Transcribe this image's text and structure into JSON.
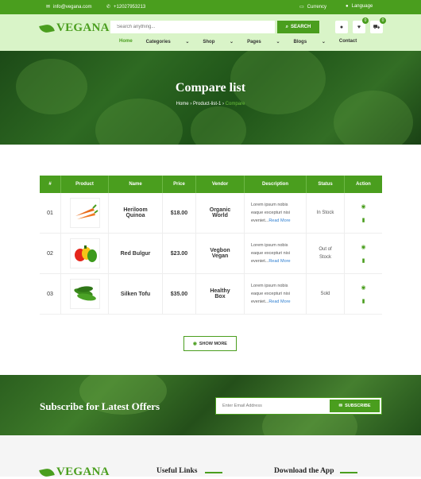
{
  "topbar": {
    "email": "info@vegana.com",
    "phone": "+12027953213",
    "currency": "Currency",
    "language": "Language"
  },
  "header": {
    "logo": "VEGANA",
    "search_placeholder": "Search anything...",
    "search_btn": "SEARCH",
    "wish_count": "0",
    "cart_count": "0"
  },
  "nav": [
    "Home",
    "Categories",
    "Shop",
    "Pages",
    "Blogs",
    "Contact"
  ],
  "hero": {
    "title": "Compare list",
    "crumbs": [
      "Home",
      "Product-list-1",
      "Compare"
    ]
  },
  "table": {
    "headers": [
      "#",
      "Product",
      "Name",
      "Price",
      "Vendor",
      "Description",
      "Status",
      "Action"
    ],
    "rows": [
      {
        "num": "01",
        "name": "Heriloom Quinoa",
        "price": "$18.00",
        "vendor": "Organic World",
        "desc": "Lorem ipsum nobis eaque excepturi nisi eveniet...",
        "more": "Read More",
        "status": "In Stock",
        "product": "carrots"
      },
      {
        "num": "02",
        "name": "Red Bulgur",
        "price": "$23.00",
        "vendor": "Vegbon Vegan",
        "desc": "Lorem ipsum nobis eaque excepturi nisi eveniet...",
        "more": "Read More",
        "status": "Out of Stock",
        "product": "peppers"
      },
      {
        "num": "03",
        "name": "Silken Tofu",
        "price": "$35.00",
        "vendor": "Healthy Box",
        "desc": "Lorem ipsum nobis eaque excepturi nisi eveniet...",
        "more": "Read More",
        "status": "Sold",
        "product": "cucumbers"
      }
    ],
    "show_more": "SHOW MORE"
  },
  "subscribe": {
    "title": "Subscribe for Latest Offers",
    "placeholder": "Enter Email Address",
    "btn": "SUBSCRIBE"
  },
  "footer": {
    "useful": "Useful Links",
    "download": "Download the App"
  },
  "colors": {
    "brand": "#4a9e1e",
    "light": "#d9f4c8"
  }
}
